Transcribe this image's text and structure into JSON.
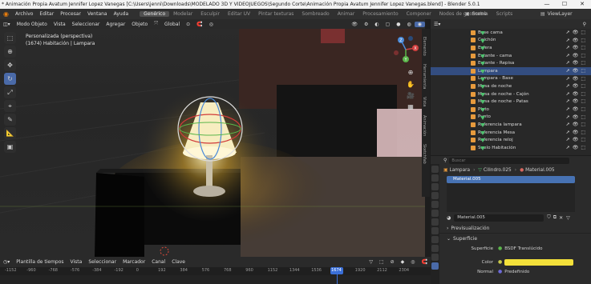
{
  "window": {
    "title": "* Animación Propia Avatum Jennifer Lopez Vanegas [C:\\Users\\jenni\\Downloads\\MODELADO 3D Y VIDEOJUEGOS\\Segundo Corte\\Animación Propia Avatum Jennifer Lopez Vanegas.blend] - Blender 5.0.1",
    "minimize": "—",
    "maximize": "☐",
    "close": "✕"
  },
  "menubar": {
    "items": [
      "Archivo",
      "Editar",
      "Procesar",
      "Ventana",
      "Ayuda"
    ],
    "workspaces": [
      "Genérico",
      "Modelar",
      "Esculpir",
      "Editar UV",
      "Pintar texturas",
      "Sombreado",
      "Animar",
      "Procesamiento",
      "Componer",
      "Nodos de geometría",
      "Scripts"
    ],
    "scene": "Scene",
    "view_layer": "ViewLayer"
  },
  "viewport_header": {
    "mode": "Modo Objeto",
    "menus": [
      "Vista",
      "Seleccionar",
      "Agregar",
      "Objeto"
    ],
    "transform": "Global"
  },
  "viewport": {
    "view_name": "Personalizada (perspectiva)",
    "object_info": "(1674) Habitación | Lampara",
    "side_tabs": [
      "Elemento",
      "Herramienta",
      "Vista",
      "Animación",
      "Sketchfab"
    ]
  },
  "gizmo": {
    "x": "X",
    "y": "Y",
    "z": "Z"
  },
  "outliner": {
    "items": [
      {
        "label": "Base cama",
        "selected": false
      },
      {
        "label": "Colchón",
        "selected": false
      },
      {
        "label": "Esfera",
        "selected": false
      },
      {
        "label": "Estante - cama",
        "selected": false
      },
      {
        "label": "Estante - Repisa",
        "selected": false
      },
      {
        "label": "Lampara",
        "selected": true
      },
      {
        "label": "Lampara - Base",
        "selected": false
      },
      {
        "label": "Mesa de noche",
        "selected": false
      },
      {
        "label": "Mesa de noche - Cajón",
        "selected": false
      },
      {
        "label": "Mesa de noche - Patas",
        "selected": false
      },
      {
        "label": "Plato",
        "selected": false
      },
      {
        "label": "Punto",
        "selected": false
      },
      {
        "label": "Referencia lampara",
        "selected": false
      },
      {
        "label": "Referencia Mesa",
        "selected": false
      },
      {
        "label": "Referencia reloj",
        "selected": false
      },
      {
        "label": "Suelo Habitación",
        "selected": false
      }
    ]
  },
  "properties": {
    "search_placeholder": "Buscar",
    "breadcrumb": [
      "Lampara",
      "Cilindro.025",
      "Material.005"
    ],
    "slot_name": "Material.005",
    "material_name": "Material.005",
    "sections": {
      "preview": "Previsualización",
      "surface": "Superficie"
    },
    "surface_label": "Superficie",
    "surface_value": "BSDF Translúcido",
    "color_label": "Color",
    "color_value": "#f3e03a",
    "normal_label": "Normal",
    "normal_value": "Predefinido"
  },
  "timeline": {
    "editor": "Plantilla de tiempos",
    "menus": [
      "Vista",
      "Seleccionar",
      "Marcador",
      "Canal",
      "Clave"
    ],
    "ticks": [
      "-1152",
      "-960",
      "-768",
      "-576",
      "-384",
      "-192",
      "0",
      "192",
      "384",
      "576",
      "768",
      "960",
      "1152",
      "1344",
      "1536",
      "1674",
      "1920",
      "2112",
      "2304"
    ],
    "current_frame": "1674"
  }
}
